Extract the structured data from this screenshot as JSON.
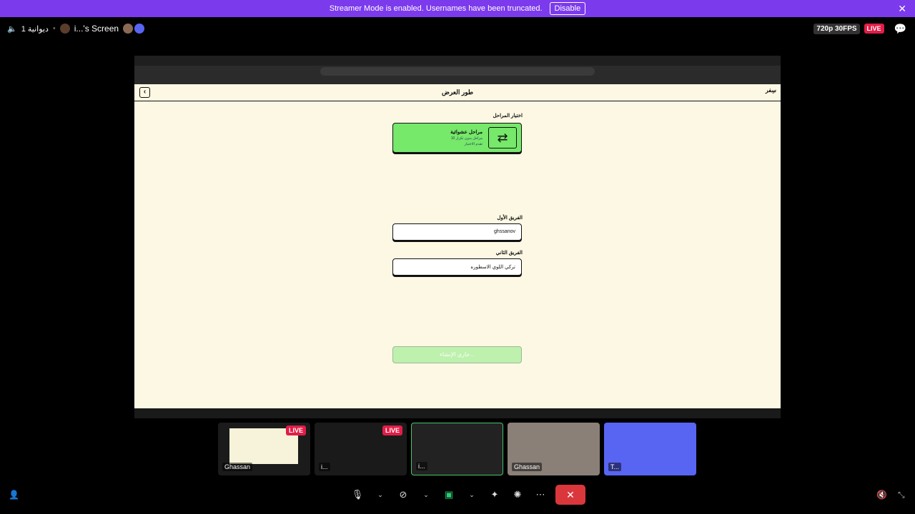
{
  "banner": {
    "text": "Streamer Mode is enabled. Usernames have been truncated.",
    "disable_label": "Disable",
    "close": "✕"
  },
  "topbar": {
    "channel": "دیوانیة 1",
    "screen_title": "i...'s Screen",
    "quality": "720p 30FPS",
    "live": "LIVE"
  },
  "app": {
    "header_title": "طور العرض",
    "back": "‹",
    "logo": "سِفر",
    "stage_label": "اختيار المراحل",
    "mode_title": "مراحل عشوائية",
    "mode_sub": "10 مراحل بدون تكرار",
    "mode_sub2": "تقدم الاختيار",
    "team1_label": "الفريق الأول",
    "team1_value": "ghssanov",
    "team2_label": "الفريق الثاني",
    "team2_value": "ترکي اللوي الاسطوره",
    "start_label": "جاري الإنشاء..."
  },
  "tiles": [
    {
      "name": "Ghassan",
      "live": "LIVE"
    },
    {
      "name": "i...",
      "live": "LIVE"
    },
    {
      "name": "i..."
    },
    {
      "name": "Ghassan"
    },
    {
      "name": "T..."
    }
  ],
  "colors": {
    "accent": "#7c3aed",
    "live": "#e11d48",
    "mode_green": "#76e86a",
    "end_call": "#da373c"
  }
}
